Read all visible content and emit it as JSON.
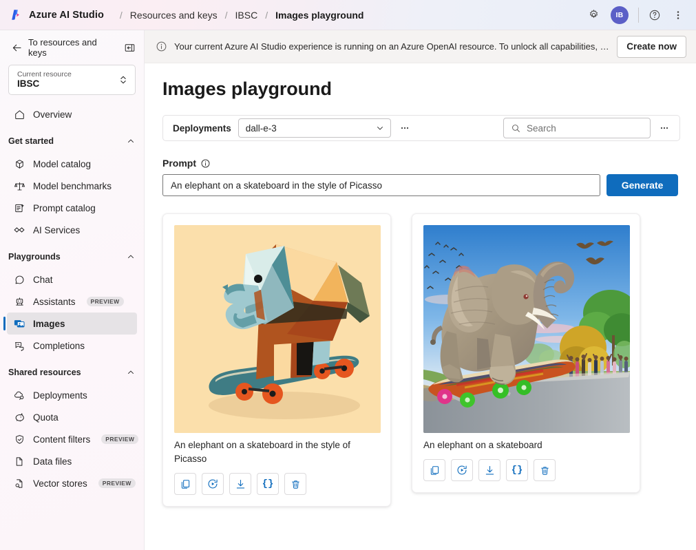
{
  "header": {
    "logo_icon": "azure-ai-studio-logo",
    "brand": "Azure AI Studio",
    "separator": "/",
    "breadcrumbs": [
      {
        "label": "Resources and keys",
        "active": false
      },
      {
        "label": "IBSC",
        "active": false
      },
      {
        "label": "Images playground",
        "active": true
      }
    ],
    "settings_icon": "gear-icon",
    "avatar_initials": "IB",
    "help_icon": "question-circle-icon",
    "more_icon": "more-vertical-icon"
  },
  "sidebar": {
    "back_label": "To resources and keys",
    "back_icon": "arrow-left-icon",
    "collapse_icon": "panel-collapse-icon",
    "resource": {
      "label": "Current resource",
      "value": "IBSC",
      "chevron_icon": "chevron-up-down-icon"
    },
    "overview": {
      "label": "Overview",
      "icon": "home-icon"
    },
    "groups": [
      {
        "title": "Get started",
        "chevron_icon": "chevron-up-icon",
        "items": [
          {
            "label": "Model catalog",
            "icon": "cube-icon",
            "badge": "",
            "selected": false
          },
          {
            "label": "Model benchmarks",
            "icon": "scales-icon",
            "badge": "",
            "selected": false
          },
          {
            "label": "Prompt catalog",
            "icon": "prompt-sparkle-icon",
            "badge": "",
            "selected": false
          },
          {
            "label": "AI Services",
            "icon": "ai-services-icon",
            "badge": "",
            "selected": false
          }
        ]
      },
      {
        "title": "Playgrounds",
        "chevron_icon": "chevron-up-icon",
        "items": [
          {
            "label": "Chat",
            "icon": "chat-bubble-icon",
            "badge": "",
            "selected": false
          },
          {
            "label": "Assistants",
            "icon": "robot-icon",
            "badge": "PREVIEW",
            "selected": false
          },
          {
            "label": "Images",
            "icon": "images-icon",
            "badge": "",
            "selected": true
          },
          {
            "label": "Completions",
            "icon": "completions-icon",
            "badge": "",
            "selected": false
          }
        ]
      },
      {
        "title": "Shared resources",
        "chevron_icon": "chevron-up-icon",
        "items": [
          {
            "label": "Deployments",
            "icon": "cloud-deploy-icon",
            "badge": "",
            "selected": false
          },
          {
            "label": "Quota",
            "icon": "piggy-bank-icon",
            "badge": "",
            "selected": false
          },
          {
            "label": "Content filters",
            "icon": "shield-check-icon",
            "badge": "PREVIEW",
            "selected": false
          },
          {
            "label": "Data files",
            "icon": "document-icon",
            "badge": "",
            "selected": false
          },
          {
            "label": "Vector stores",
            "icon": "document-search-icon",
            "badge": "PREVIEW",
            "selected": false
          }
        ]
      }
    ]
  },
  "banner": {
    "info_icon": "info-circle-icon",
    "text": "Your current Azure AI Studio experience is running on an Azure OpenAI resource. To unlock all capabilities, create a…",
    "button_label": "Create now"
  },
  "main": {
    "page_title": "Images playground",
    "toolbar": {
      "deployments_label": "Deployments",
      "deployment_value": "dall-e-3",
      "deployment_chevron_icon": "chevron-down-icon",
      "deployment_more_icon": "more-horizontal-icon",
      "search_icon": "search-icon",
      "search_value": "",
      "search_placeholder": "Search",
      "toolbar_more_icon": "more-horizontal-icon"
    },
    "prompt": {
      "label": "Prompt",
      "info_icon": "info-circle-icon",
      "value": "An elephant on a skateboard in the style of Picasso",
      "placeholder": "",
      "generate_label": "Generate"
    },
    "cards": [
      {
        "caption": "An elephant on a skateboard in the style of Picasso",
        "image_alt": "cubist-geometric-elephant-on-teal-skateboard",
        "actions": [
          {
            "icon": "copy-icon",
            "label": "Copy"
          },
          {
            "icon": "regenerate-icon",
            "label": "Regenerate"
          },
          {
            "icon": "download-icon",
            "label": "Download"
          },
          {
            "icon": "json-braces-icon",
            "label": "{}"
          },
          {
            "icon": "trash-icon",
            "label": "Delete"
          }
        ]
      },
      {
        "caption": "An elephant on a skateboard",
        "image_alt": "realistic-elephant-riding-colorful-skateboard-with-crowd",
        "actions": [
          {
            "icon": "copy-icon",
            "label": "Copy"
          },
          {
            "icon": "regenerate-icon",
            "label": "Regenerate"
          },
          {
            "icon": "download-icon",
            "label": "Download"
          },
          {
            "icon": "json-braces-icon",
            "label": "{}"
          },
          {
            "icon": "trash-icon",
            "label": "Delete"
          }
        ]
      }
    ]
  },
  "colors": {
    "accent": "#0f6cbd",
    "avatar": "#5b5fc7",
    "sidebar_selected": "#e6e3e6",
    "banner_bg": "#f5f3f2"
  }
}
